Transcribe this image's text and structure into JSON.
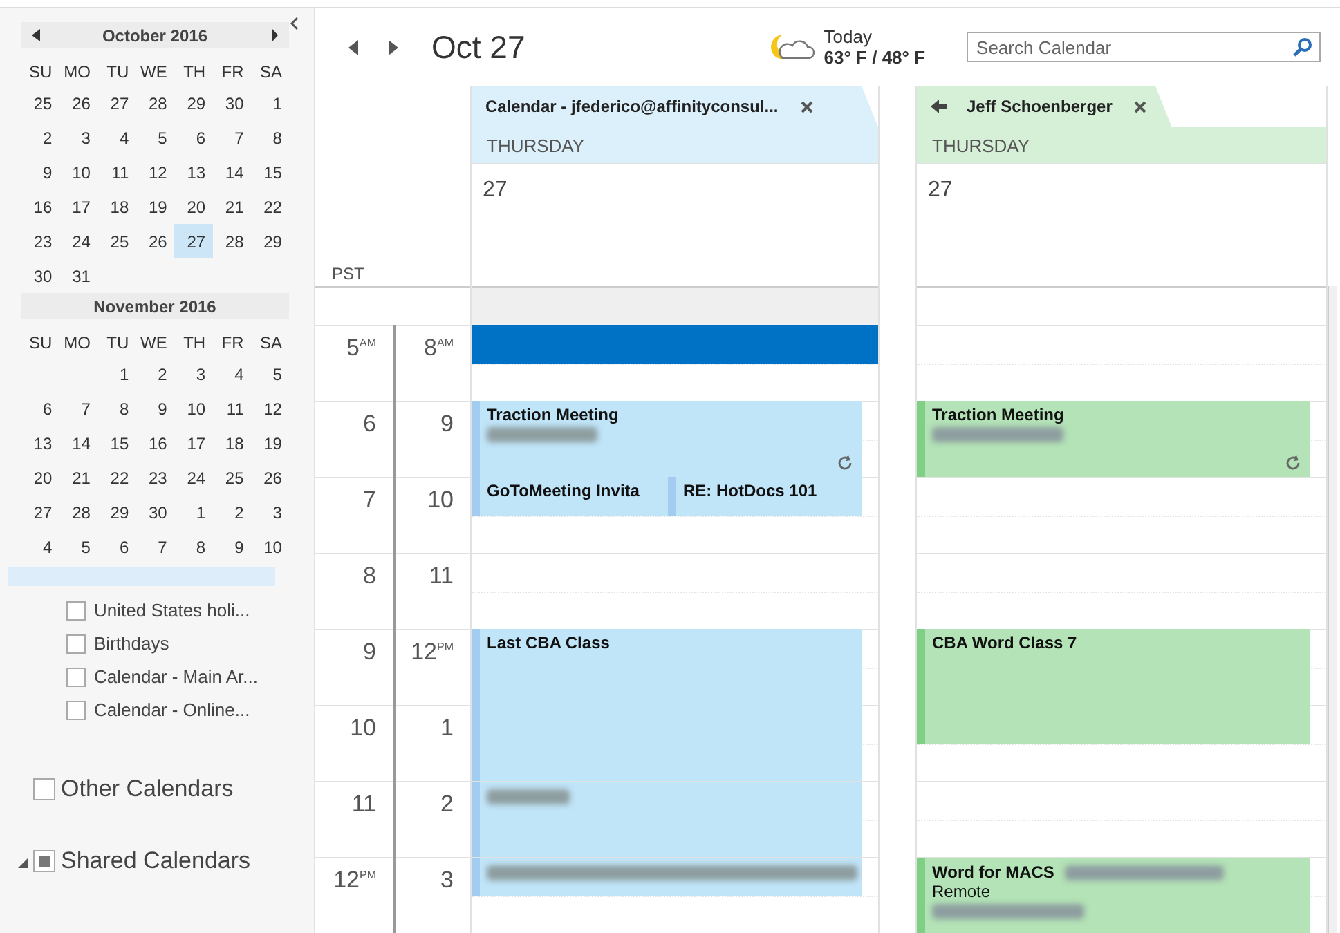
{
  "mini_calendar": {
    "months": [
      {
        "title": "October 2016",
        "weekdays": [
          "SU",
          "MO",
          "TU",
          "WE",
          "TH",
          "FR",
          "SA"
        ],
        "weeks": [
          [
            {
              "day": "25",
              "selected": false
            },
            {
              "day": "26",
              "selected": false
            },
            {
              "day": "27",
              "selected": false
            },
            {
              "day": "28",
              "selected": false
            },
            {
              "day": "29",
              "selected": false
            },
            {
              "day": "30",
              "selected": false
            },
            {
              "day": "1",
              "selected": false
            }
          ],
          [
            {
              "day": "2",
              "selected": false
            },
            {
              "day": "3",
              "selected": false
            },
            {
              "day": "4",
              "selected": false
            },
            {
              "day": "5",
              "selected": false
            },
            {
              "day": "6",
              "selected": false
            },
            {
              "day": "7",
              "selected": false
            },
            {
              "day": "8",
              "selected": false
            }
          ],
          [
            {
              "day": "9",
              "selected": false
            },
            {
              "day": "10",
              "selected": false
            },
            {
              "day": "11",
              "selected": false
            },
            {
              "day": "12",
              "selected": false
            },
            {
              "day": "13",
              "selected": false
            },
            {
              "day": "14",
              "selected": false
            },
            {
              "day": "15",
              "selected": false
            }
          ],
          [
            {
              "day": "16",
              "selected": false
            },
            {
              "day": "17",
              "selected": false
            },
            {
              "day": "18",
              "selected": false
            },
            {
              "day": "19",
              "selected": false
            },
            {
              "day": "20",
              "selected": false
            },
            {
              "day": "21",
              "selected": false
            },
            {
              "day": "22",
              "selected": false
            }
          ],
          [
            {
              "day": "23",
              "selected": false
            },
            {
              "day": "24",
              "selected": false
            },
            {
              "day": "25",
              "selected": false
            },
            {
              "day": "26",
              "selected": false
            },
            {
              "day": "27",
              "selected": true
            },
            {
              "day": "28",
              "selected": false
            },
            {
              "day": "29",
              "selected": false
            }
          ],
          [
            {
              "day": "30",
              "selected": false
            },
            {
              "day": "31",
              "selected": false
            }
          ]
        ]
      },
      {
        "title": "November 2016",
        "weekdays": [
          "SU",
          "MO",
          "TU",
          "WE",
          "TH",
          "FR",
          "SA"
        ],
        "weeks": [
          [
            {
              "day": "1",
              "selected": false
            },
            {
              "day": "2",
              "selected": false
            },
            {
              "day": "3",
              "selected": false
            },
            {
              "day": "4",
              "selected": false
            },
            {
              "day": "5",
              "selected": false
            }
          ],
          [
            {
              "day": "6",
              "selected": false
            },
            {
              "day": "7",
              "selected": false
            },
            {
              "day": "8",
              "selected": false
            },
            {
              "day": "9",
              "selected": false
            },
            {
              "day": "10",
              "selected": false
            },
            {
              "day": "11",
              "selected": false
            },
            {
              "day": "12",
              "selected": false
            }
          ],
          [
            {
              "day": "13",
              "selected": false
            },
            {
              "day": "14",
              "selected": false
            },
            {
              "day": "15",
              "selected": false
            },
            {
              "day": "16",
              "selected": false
            },
            {
              "day": "17",
              "selected": false
            },
            {
              "day": "18",
              "selected": false
            },
            {
              "day": "19",
              "selected": false
            }
          ],
          [
            {
              "day": "20",
              "selected": false
            },
            {
              "day": "21",
              "selected": false
            },
            {
              "day": "22",
              "selected": false
            },
            {
              "day": "23",
              "selected": false
            },
            {
              "day": "24",
              "selected": false
            },
            {
              "day": "25",
              "selected": false
            },
            {
              "day": "26",
              "selected": false
            }
          ],
          [
            {
              "day": "27",
              "selected": false
            },
            {
              "day": "28",
              "selected": false
            },
            {
              "day": "29",
              "selected": false
            },
            {
              "day": "30",
              "selected": false
            },
            {
              "day": "1",
              "selected": false
            },
            {
              "day": "2",
              "selected": false
            },
            {
              "day": "3",
              "selected": false
            }
          ],
          [
            {
              "day": "4",
              "selected": false
            },
            {
              "day": "5",
              "selected": false
            },
            {
              "day": "6",
              "selected": false
            },
            {
              "day": "7",
              "selected": false
            },
            {
              "day": "8",
              "selected": false
            },
            {
              "day": "9",
              "selected": false
            },
            {
              "day": "10",
              "selected": false
            }
          ]
        ]
      }
    ]
  },
  "calendar_list": {
    "items": [
      {
        "label": "United States holi...",
        "checked": false
      },
      {
        "label": "Birthdays",
        "checked": false
      },
      {
        "label": "Calendar - Main Ar...",
        "checked": false
      },
      {
        "label": "Calendar - Online...",
        "checked": false
      }
    ],
    "groups": [
      {
        "label": "Other Calendars",
        "checked": false
      },
      {
        "label": "Shared Calendars",
        "checked": true,
        "expanded": true
      }
    ]
  },
  "header": {
    "date": "Oct 27",
    "weather": {
      "day": "Today",
      "temperature": "63° F / 48° F"
    },
    "search": {
      "placeholder": "Search Calendar"
    }
  },
  "time_scales": [
    {
      "label": "PST",
      "hours": [
        {
          "hour": "5",
          "suffix": "AM"
        },
        {
          "hour": "6"
        },
        {
          "hour": "7"
        },
        {
          "hour": "8"
        },
        {
          "hour": "9"
        },
        {
          "hour": "10"
        },
        {
          "hour": "11"
        },
        {
          "hour": "12",
          "suffix": "PM"
        }
      ]
    },
    {
      "hours": [
        {
          "hour": "8",
          "suffix": "AM"
        },
        {
          "hour": "9"
        },
        {
          "hour": "10"
        },
        {
          "hour": "11"
        },
        {
          "hour": "12",
          "suffix": "PM"
        },
        {
          "hour": "1"
        },
        {
          "hour": "2"
        },
        {
          "hour": "3"
        }
      ]
    }
  ],
  "calendars": [
    {
      "name": "Calendar - jfederico@affinityconsul...",
      "color": "#c0e4f8",
      "selected": true,
      "overlay_arrow": false,
      "slot_selected": true,
      "weekday": "THURSDAY",
      "date": "27",
      "events": [
        {
          "title": "Traction Meeting",
          "recurring": true
        },
        {
          "title": "GoToMeeting Invita",
          "recurring": false
        },
        {
          "title": "RE: HotDocs 101",
          "recurring": false
        },
        {
          "title": "Last CBA Class",
          "recurring": false
        },
        {
          "recurring": false
        },
        {
          "recurring": false
        }
      ]
    },
    {
      "name": "Jeff Schoenberger",
      "color": "#b3e3b6",
      "selected": false,
      "overlay_arrow": true,
      "slot_selected": false,
      "weekday": "THURSDAY",
      "date": "27",
      "events": [
        {
          "title": "Traction Meeting",
          "recurring": true
        },
        {
          "title": "CBA Word Class 7",
          "recurring": false
        },
        {
          "title": "Word for MACS",
          "location": "Remote",
          "recurring": false
        }
      ]
    }
  ]
}
